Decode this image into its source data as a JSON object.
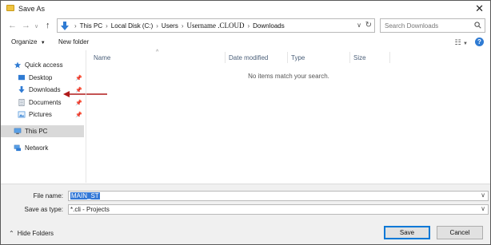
{
  "window": {
    "title": "Save As"
  },
  "address": {
    "crumbs": [
      "This PC",
      "Local Disk (C:)",
      "Users",
      "Username .CLOUD",
      "Downloads"
    ]
  },
  "search": {
    "placeholder": "Search Downloads"
  },
  "toolbar": {
    "organize_label": "Organize",
    "new_folder_label": "New folder"
  },
  "nav": {
    "quick_access": "Quick access",
    "items": [
      {
        "label": "Desktop",
        "icon": "desktop-icon",
        "pinned": true
      },
      {
        "label": "Downloads",
        "icon": "downloads-icon",
        "pinned": true
      },
      {
        "label": "Documents",
        "icon": "documents-icon",
        "pinned": true
      },
      {
        "label": "Pictures",
        "icon": "pictures-icon",
        "pinned": true
      }
    ],
    "this_pc": "This PC",
    "network": "Network"
  },
  "columns": [
    "Name",
    "Date modified",
    "Type",
    "Size"
  ],
  "empty_message": "No items match your search.",
  "footer": {
    "file_name_label": "File name:",
    "file_name_value": "MAIN_ST",
    "save_as_type_label": "Save as type:",
    "save_as_type_value": "*.cli - Projects",
    "hide_folders_label": "Hide Folders",
    "save_label": "Save",
    "cancel_label": "Cancel"
  },
  "colors": {
    "accent": "#0078d7",
    "selection": "#3277d6",
    "annotation_arrow": "#b01a1a"
  }
}
